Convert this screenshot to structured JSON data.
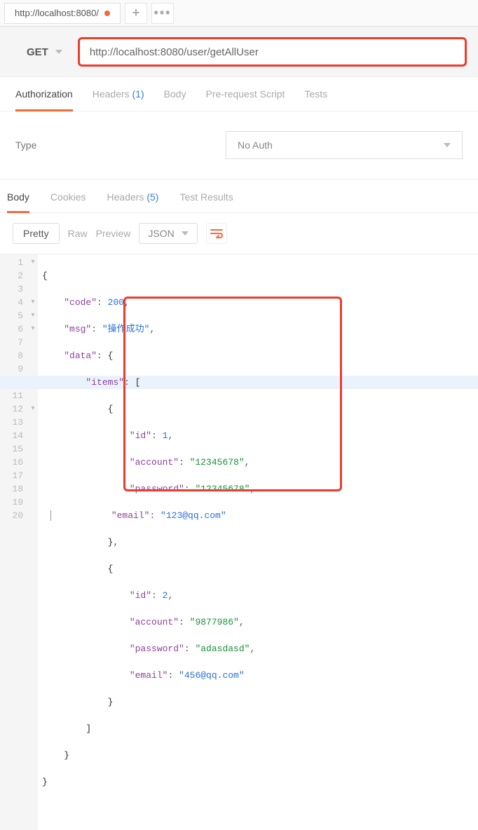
{
  "tab": {
    "title": "http://localhost:8080/"
  },
  "request": {
    "method": "GET",
    "url": "http://localhost:8080/user/getAllUser"
  },
  "subtabs": {
    "authorization": "Authorization",
    "headers_label": "Headers",
    "headers_count": "(1)",
    "body": "Body",
    "prerequest": "Pre-request Script",
    "tests": "Tests"
  },
  "auth": {
    "type_label": "Type",
    "selected": "No Auth"
  },
  "response_tabs": {
    "body": "Body",
    "cookies": "Cookies",
    "headers_label": "Headers",
    "headers_count": "(5)",
    "test_results": "Test Results"
  },
  "toolbar": {
    "pretty": "Pretty",
    "raw": "Raw",
    "preview": "Preview",
    "format": "JSON"
  },
  "json_literals": {
    "brace_open": "{",
    "brace_close": "}",
    "bracket_open": "[",
    "bracket_close": "]",
    "comma": ","
  },
  "body": {
    "code_key": "\"code\"",
    "code_val": "200",
    "msg_key": "\"msg\"",
    "msg_val": "\"操作成功\"",
    "data_key": "\"data\"",
    "items_key": "\"items\"",
    "id_key": "\"id\"",
    "account_key": "\"account\"",
    "password_key": "\"password\"",
    "email_key": "\"email\"",
    "items": [
      {
        "id": "1",
        "account": "\"12345678\"",
        "password": "\"12345678\"",
        "email": "\"123@qq.com\""
      },
      {
        "id": "2",
        "account": "\"9877986\"",
        "password": "\"adasdasd\"",
        "email": "\"456@qq.com\""
      }
    ]
  }
}
